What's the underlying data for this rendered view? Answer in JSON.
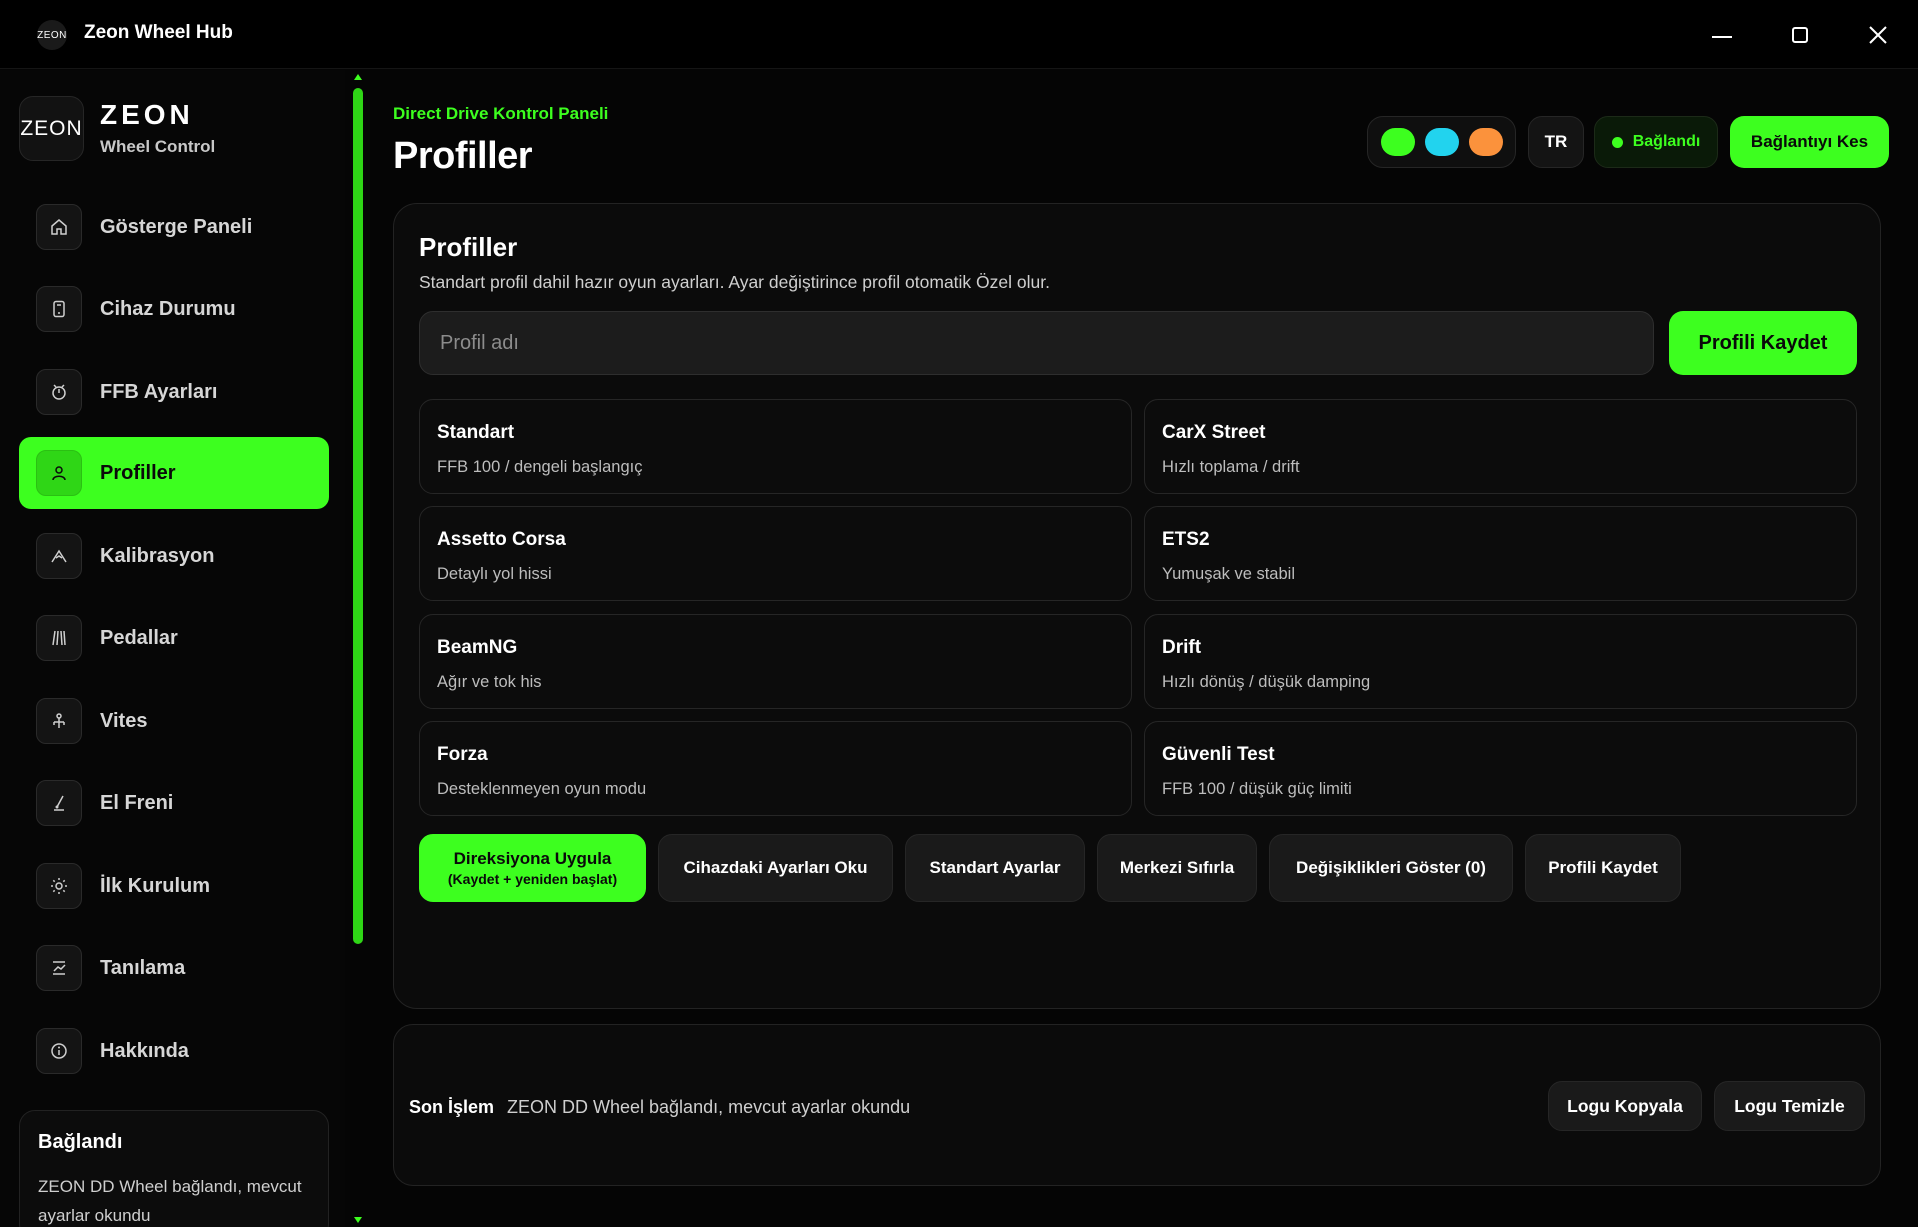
{
  "titlebar": {
    "logo_text": "ZEON",
    "title": "Zeon Wheel Hub"
  },
  "sidebar": {
    "brand_logo": "ZEON",
    "brand_name": "ZEON",
    "brand_sub": "Wheel Control",
    "items": [
      {
        "label": "Gösterge Paneli",
        "icon": "home-icon"
      },
      {
        "label": "Cihaz Durumu",
        "icon": "device-icon"
      },
      {
        "label": "FFB Ayarları",
        "icon": "ffb-icon"
      },
      {
        "label": "Profiller",
        "icon": "user-icon",
        "active": true
      },
      {
        "label": "Kalibrasyon",
        "icon": "calibration-icon"
      },
      {
        "label": "Pedallar",
        "icon": "pedals-icon"
      },
      {
        "label": "Vites",
        "icon": "gear-shift-icon"
      },
      {
        "label": "El Freni",
        "icon": "handbrake-icon"
      },
      {
        "label": "İlk Kurulum",
        "icon": "setup-icon"
      },
      {
        "label": "Tanılama",
        "icon": "diagnostics-icon"
      },
      {
        "label": "Hakkında",
        "icon": "info-icon"
      }
    ],
    "status_card": {
      "title": "Bağlandı",
      "desc": "ZEON DD Wheel bağlandı, mevcut ayarlar okundu"
    }
  },
  "header": {
    "eyebrow": "Direct Drive Kontrol Paneli",
    "title": "Profiller",
    "theme_colors": [
      "#3dff1f",
      "#22d3ee",
      "#fb923c"
    ],
    "lang": "TR",
    "connection_status": "Bağlandı",
    "disconnect_label": "Bağlantıyı Kes"
  },
  "profiles_panel": {
    "title": "Profiller",
    "desc": "Standart profil dahil hazır oyun ayarları. Ayar değiştirince profil otomatik Özel olur.",
    "name_placeholder": "Profil adı",
    "save_label": "Profili Kaydet",
    "profiles": [
      {
        "name": "Standart",
        "desc": "FFB 100 / dengeli başlangıç"
      },
      {
        "name": "CarX Street",
        "desc": "Hızlı toplama / drift"
      },
      {
        "name": "Assetto Corsa",
        "desc": "Detaylı yol hissi"
      },
      {
        "name": "ETS2",
        "desc": "Yumuşak ve stabil"
      },
      {
        "name": "BeamNG",
        "desc": "Ağır ve tok his"
      },
      {
        "name": "Drift",
        "desc": "Hızlı dönüş / düşük damping"
      },
      {
        "name": "Forza",
        "desc": "Desteklenmeyen oyun modu"
      },
      {
        "name": "Güvenli Test",
        "desc": "FFB 100 / düşük güç limiti"
      }
    ],
    "actions": {
      "apply_label": "Direksiyona Uygula",
      "apply_sub": "(Kaydet + yeniden başlat)",
      "read_label": "Cihazdaki Ayarları Oku",
      "defaults_label": "Standart Ayarlar",
      "center_label": "Merkezi Sıfırla",
      "changes_label": "Değişiklikleri Göster (0)",
      "save_label": "Profili Kaydet"
    }
  },
  "log": {
    "label": "Son İşlem",
    "message": "ZEON DD Wheel bağlandı, mevcut ayarlar okundu",
    "copy_label": "Logu Kopyala",
    "clear_label": "Logu Temizle"
  }
}
